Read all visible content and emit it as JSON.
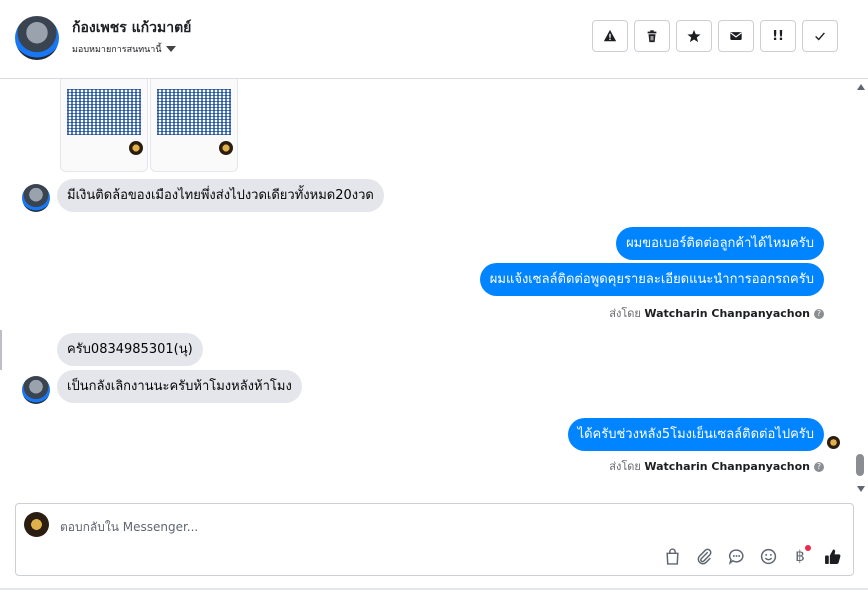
{
  "header": {
    "contact_name": "ก้องเพชร แก้วมาตย์",
    "assign_label": "มอบหมายการสนทนานี้",
    "actions": [
      {
        "icon": "warning-icon"
      },
      {
        "icon": "trash-icon"
      },
      {
        "icon": "star-icon"
      },
      {
        "icon": "mail-icon"
      },
      {
        "icon": "follow-up-icon",
        "label": "!!"
      },
      {
        "icon": "check-icon"
      }
    ]
  },
  "thread": {
    "messages": [
      {
        "type": "incoming",
        "text": "มีเงินติดล้อของเมืองไทยพึ่งส่งไปงวดเดียวทั้งหมด20งวด"
      },
      {
        "type": "outgoing",
        "text": "ผมขอเบอร์ติดต่อลูกค้าได้ไหมครับ"
      },
      {
        "type": "outgoing",
        "text": "ผมแจ้งเซลล์ติดต่อพูดคุยรายละเอียดแนะนำการออกรถครับ"
      },
      {
        "type": "incoming",
        "text": "ครับ0834985301(นุ)"
      },
      {
        "type": "incoming",
        "text": "เป็นกลังเลิกงานนะครับห้าโมงหลังห้าโมง"
      },
      {
        "type": "outgoing",
        "text": "ได้ครับช่วงหลัง5โมงเย็นเซลล์ติดต่อไปครับ"
      }
    ],
    "sent_by_prefix": "ส่งโดย",
    "sent_by_name": "Watcharin Chanpanyachon",
    "help_mark": "?"
  },
  "composer": {
    "placeholder": "ตอบกลับใน Messenger...",
    "tools": [
      "bag-icon",
      "paperclip-icon",
      "chat-bubble-icon",
      "emoji-icon",
      "baht-icon",
      "like-icon"
    ],
    "baht_symbol": "฿"
  },
  "colors": {
    "outgoing_bubble": "#0084ff",
    "incoming_bubble": "#e4e6eb",
    "notification_dot": "#f02849"
  }
}
